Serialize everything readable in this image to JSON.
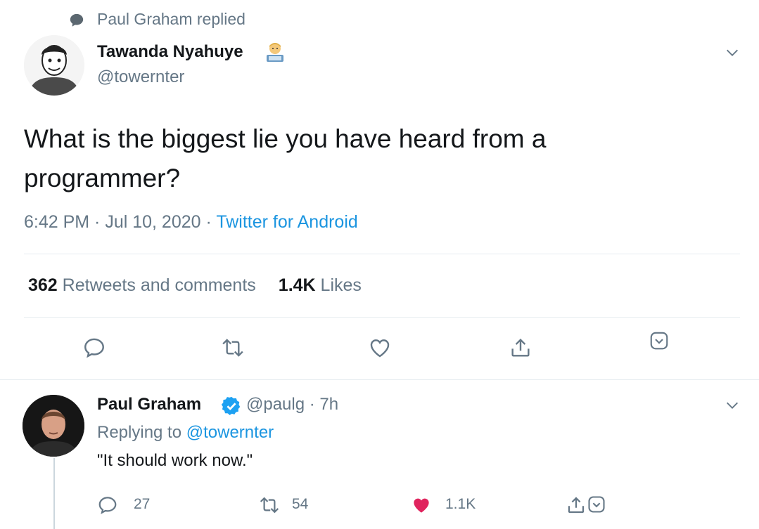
{
  "context": {
    "text": "Paul Graham replied",
    "icon": "speech-bubble-icon"
  },
  "tweet": {
    "author_name": "Tawanda Nyahuye",
    "author_emoji": "technologist-emoji",
    "author_handle": "@towernter",
    "text": "What is the biggest lie you have heard from a programmer?",
    "time": "6:42 PM · Jul 10, 2020 · ",
    "source": "Twitter for Android",
    "retweets_count": "362",
    "retweets_label": " Retweets and comments",
    "likes_count": "1.4K",
    "likes_label": " Likes",
    "actions": [
      "reply-icon",
      "retweet-icon",
      "like-icon",
      "share-icon",
      "more-icon"
    ]
  },
  "reply": {
    "author_name": "Paul Graham",
    "author_handle": "@paulg · 7h",
    "replying_prefix": "Replying to ",
    "replying_handle": "@towernter",
    "text": "\"It should work now.\"",
    "reply_count": "27",
    "retweet_count": "54",
    "like_count": "1.1K"
  },
  "colors": {
    "accent": "#1b95e0",
    "like": "#e0245e",
    "muted": "#657786",
    "text": "#14171a"
  }
}
